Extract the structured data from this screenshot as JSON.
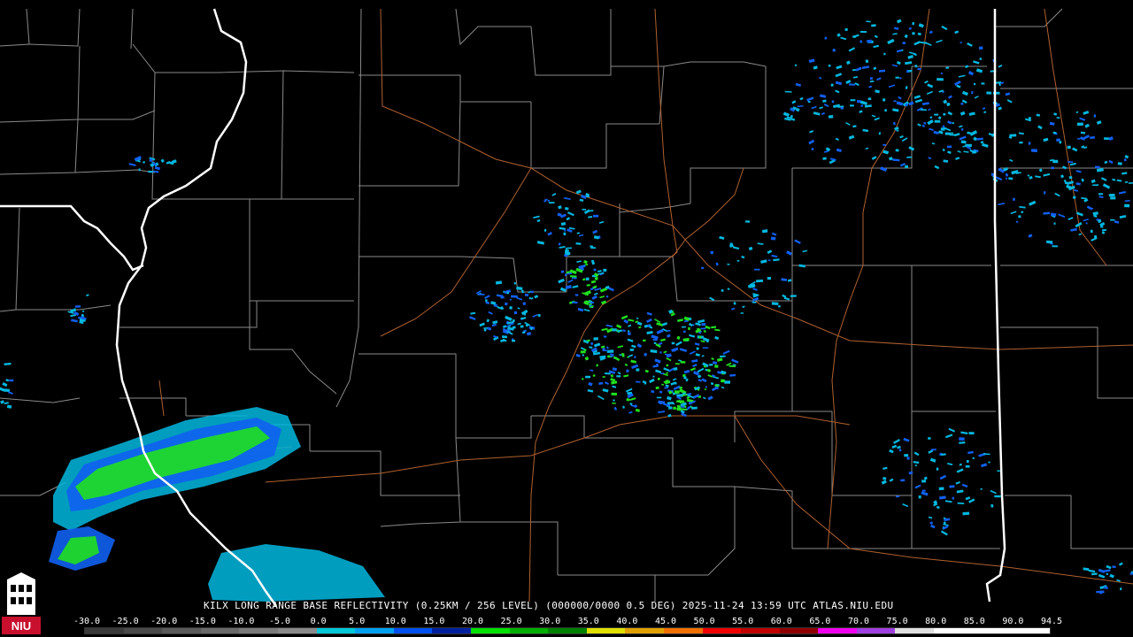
{
  "caption": "KILX LONG RANGE BASE REFLECTIVITY (0.25KM / 256 LEVEL) (000000/0000 0.5 DEG) 2025-11-24 13:59 UTC  ATLAS.NIU.EDU",
  "logo_text": "NIU",
  "scale": {
    "labels": [
      "-30.0",
      "-25.0",
      "-20.0",
      "-15.0",
      "-10.0",
      "-5.0",
      "0.0",
      "5.0",
      "10.0",
      "15.0",
      "20.0",
      "25.0",
      "30.0",
      "35.0",
      "40.0",
      "45.0",
      "50.0",
      "55.0",
      "60.0",
      "65.0",
      "70.0",
      "75.0",
      "80.0",
      "85.0",
      "90.0",
      "94.5"
    ],
    "colors": [
      "#3a3a3a",
      "#4a4a4a",
      "#5a5a5a",
      "#6a6a6a",
      "#7a7a7a",
      "#8a8a8a",
      "#00c8d8",
      "#00a0f0",
      "#0050f0",
      "#0020a0",
      "#00e000",
      "#00b000",
      "#008000",
      "#e0e000",
      "#e0a000",
      "#f07000",
      "#f00000",
      "#c00000",
      "#900000",
      "#f000f0",
      "#a040e0",
      "#e0e0e0",
      "#ffffff",
      "#ffffff",
      "#ffffff"
    ]
  },
  "colors": {
    "background": "#000000",
    "county_lines": "#8a8a8a",
    "state_lines": "#ffffff",
    "highways": "#b06030",
    "echo_weak": "#00b8e0",
    "echo_mid": "#1060f0",
    "echo_green": "#20e020"
  }
}
